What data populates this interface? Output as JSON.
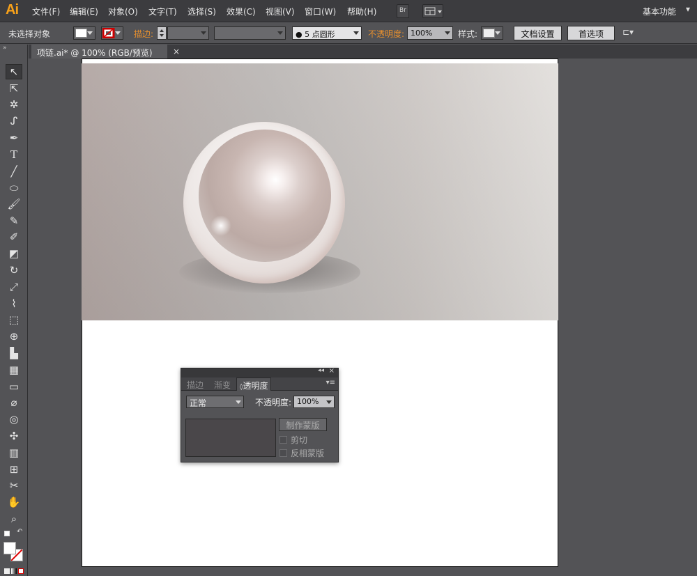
{
  "app": {
    "logo": "Ai"
  },
  "menu": [
    "文件(F)",
    "编辑(E)",
    "对象(O)",
    "文字(T)",
    "选择(S)",
    "效果(C)",
    "视图(V)",
    "窗口(W)",
    "帮助(H)"
  ],
  "bridge_label": "Br",
  "workspace_label": "基本功能",
  "control": {
    "selection_status": "未选择对象",
    "stroke_label": "描边",
    "brush_label": "5 点圆形",
    "opacity_label": "不透明度",
    "opacity_value": "100%",
    "style_label": "样式",
    "doc_setup": "文档设置",
    "preferences": "首选项"
  },
  "document": {
    "tab_title": "项链.ai* @ 100% (RGB/预览)",
    "close": "×"
  },
  "panel": {
    "tabs": [
      "描边",
      "渐变",
      "透明度"
    ],
    "blend_mode": "正常",
    "opacity_label": "不透明度",
    "opacity_value": "100%",
    "make_mask": "制作蒙版",
    "clip": "剪切",
    "invert_mask": "反相蒙版"
  },
  "colors": {
    "accent": "#e8902e",
    "menubar": "#3c3c3f",
    "panel": "#535356"
  }
}
